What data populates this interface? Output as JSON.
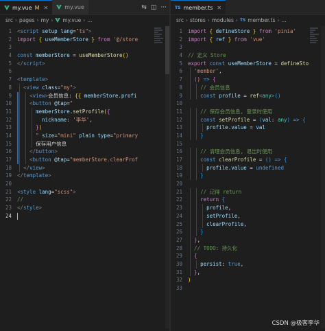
{
  "left": {
    "tabs": [
      {
        "label": "my.vue",
        "modified": "M",
        "active": true
      },
      {
        "label": "my.vue",
        "modified": "",
        "active": false
      }
    ],
    "breadcrumb": [
      "src",
      "pages",
      "my",
      "my.vue",
      "..."
    ],
    "lines": [
      {
        "n": "1",
        "parts": [
          [
            "t-punc",
            "<"
          ],
          [
            "t-tag",
            "script"
          ],
          [
            "t-txt",
            " "
          ],
          [
            "t-attr",
            "setup"
          ],
          [
            "t-txt",
            " "
          ],
          [
            "t-attr",
            "lang"
          ],
          [
            "t-txt",
            "="
          ],
          [
            "t-str",
            "\"ts\""
          ],
          [
            "t-punc",
            ">"
          ]
        ]
      },
      {
        "n": "2",
        "parts": [
          [
            "t-kw",
            "import"
          ],
          [
            "t-txt",
            " "
          ],
          [
            "t-br1",
            "{"
          ],
          [
            "t-txt",
            " "
          ],
          [
            "t-var",
            "useMemberStore"
          ],
          [
            "t-txt",
            " "
          ],
          [
            "t-br1",
            "}"
          ],
          [
            "t-txt",
            " "
          ],
          [
            "t-kw",
            "from"
          ],
          [
            "t-txt",
            " "
          ],
          [
            "t-str",
            "'@/store"
          ]
        ]
      },
      {
        "n": "3",
        "parts": []
      },
      {
        "n": "4",
        "parts": [
          [
            "t-decl",
            "const"
          ],
          [
            "t-txt",
            " "
          ],
          [
            "t-var",
            "memberStore"
          ],
          [
            "t-txt",
            " = "
          ],
          [
            "t-fn",
            "useMemberStore"
          ],
          [
            "t-br1",
            "()"
          ]
        ]
      },
      {
        "n": "5",
        "parts": [
          [
            "t-punc",
            "</"
          ],
          [
            "t-tag",
            "script"
          ],
          [
            "t-punc",
            ">"
          ]
        ]
      },
      {
        "n": "6",
        "parts": []
      },
      {
        "n": "7",
        "parts": [
          [
            "t-punc",
            "<"
          ],
          [
            "t-tag",
            "template"
          ],
          [
            "t-punc",
            ">"
          ]
        ]
      },
      {
        "n": "8",
        "parts": [
          [
            "t-txt",
            "  "
          ],
          [
            "t-punc",
            "<"
          ],
          [
            "t-tag",
            "view"
          ],
          [
            "t-txt",
            " "
          ],
          [
            "t-attr",
            "class"
          ],
          [
            "t-txt",
            "="
          ],
          [
            "t-str",
            "\"my\""
          ],
          [
            "t-punc",
            ">"
          ]
        ]
      },
      {
        "n": "9",
        "parts": [
          [
            "t-txt",
            "    "
          ],
          [
            "t-punc",
            "<"
          ],
          [
            "t-tag",
            "view"
          ],
          [
            "t-punc",
            ">"
          ],
          [
            "t-txt",
            "会员信息: "
          ],
          [
            "t-br1",
            "{{"
          ],
          [
            "t-txt",
            " "
          ],
          [
            "t-var",
            "memberStore"
          ],
          [
            "t-txt",
            "."
          ],
          [
            "t-var",
            "profi"
          ]
        ]
      },
      {
        "n": "10",
        "parts": [
          [
            "t-txt",
            "    "
          ],
          [
            "t-punc",
            "<"
          ],
          [
            "t-tag",
            "button"
          ],
          [
            "t-txt",
            " "
          ],
          [
            "t-attr",
            "@tap"
          ],
          [
            "t-txt",
            "="
          ],
          [
            "t-str",
            "\""
          ]
        ]
      },
      {
        "n": "11",
        "parts": [
          [
            "t-txt",
            "      "
          ],
          [
            "t-var",
            "memberStore"
          ],
          [
            "t-txt",
            "."
          ],
          [
            "t-fn",
            "setProfile"
          ],
          [
            "t-br1",
            "("
          ],
          [
            "t-br2",
            "{"
          ]
        ]
      },
      {
        "n": "12",
        "parts": [
          [
            "t-txt",
            "        "
          ],
          [
            "t-var",
            "nickname"
          ],
          [
            "t-txt",
            ": "
          ],
          [
            "t-str",
            "'李华'"
          ],
          [
            "t-txt",
            ","
          ]
        ]
      },
      {
        "n": "13",
        "parts": [
          [
            "t-txt",
            "      "
          ],
          [
            "t-br2",
            "}"
          ],
          [
            "t-br1",
            ")"
          ]
        ]
      },
      {
        "n": "14",
        "parts": [
          [
            "t-txt",
            "      "
          ],
          [
            "t-str",
            "\""
          ],
          [
            "t-txt",
            " "
          ],
          [
            "t-attr",
            "size"
          ],
          [
            "t-txt",
            "="
          ],
          [
            "t-str",
            "\"mini\""
          ],
          [
            "t-txt",
            " "
          ],
          [
            "t-attr",
            "plain"
          ],
          [
            "t-txt",
            " "
          ],
          [
            "t-attr",
            "type"
          ],
          [
            "t-txt",
            "="
          ],
          [
            "t-str",
            "\"primary"
          ]
        ]
      },
      {
        "n": "15",
        "parts": [
          [
            "t-txt",
            "      保存用户信息"
          ]
        ]
      },
      {
        "n": "16",
        "parts": [
          [
            "t-txt",
            "    "
          ],
          [
            "t-punc",
            "</"
          ],
          [
            "t-tag",
            "button"
          ],
          [
            "t-punc",
            ">"
          ]
        ]
      },
      {
        "n": "17",
        "parts": [
          [
            "t-txt",
            "    "
          ],
          [
            "t-punc",
            "<"
          ],
          [
            "t-tag",
            "button"
          ],
          [
            "t-txt",
            " "
          ],
          [
            "t-attr",
            "@tap"
          ],
          [
            "t-txt",
            "="
          ],
          [
            "t-str",
            "\"memberStore.clearProf"
          ]
        ]
      },
      {
        "n": "18",
        "parts": [
          [
            "t-txt",
            "  "
          ],
          [
            "t-punc",
            "</"
          ],
          [
            "t-tag",
            "view"
          ],
          [
            "t-punc",
            ">"
          ]
        ]
      },
      {
        "n": "19",
        "parts": [
          [
            "t-punc",
            "</"
          ],
          [
            "t-tag",
            "template"
          ],
          [
            "t-punc",
            ">"
          ]
        ]
      },
      {
        "n": "20",
        "parts": []
      },
      {
        "n": "21",
        "parts": [
          [
            "t-punc",
            "<"
          ],
          [
            "t-tag",
            "style"
          ],
          [
            "t-txt",
            " "
          ],
          [
            "t-attr",
            "lang"
          ],
          [
            "t-txt",
            "="
          ],
          [
            "t-str",
            "\"scss\""
          ],
          [
            "t-punc",
            ">"
          ]
        ]
      },
      {
        "n": "22",
        "parts": [
          [
            "t-com",
            "//"
          ]
        ]
      },
      {
        "n": "23",
        "parts": [
          [
            "t-punc",
            "</"
          ],
          [
            "t-tag",
            "style"
          ],
          [
            "t-punc",
            ">"
          ]
        ]
      },
      {
        "n": "24",
        "parts": [],
        "current": true
      }
    ]
  },
  "right": {
    "tabs": [
      {
        "label": "member.ts",
        "modified": "",
        "active": true
      }
    ],
    "breadcrumb": [
      "src",
      "stores",
      "modules",
      "member.ts",
      "..."
    ],
    "lines": [
      {
        "n": "1",
        "parts": [
          [
            "t-kw",
            "import"
          ],
          [
            "t-txt",
            " "
          ],
          [
            "t-br1",
            "{"
          ],
          [
            "t-txt",
            " "
          ],
          [
            "t-var",
            "defineStore"
          ],
          [
            "t-txt",
            " "
          ],
          [
            "t-br1",
            "}"
          ],
          [
            "t-txt",
            " "
          ],
          [
            "t-kw",
            "from"
          ],
          [
            "t-txt",
            " "
          ],
          [
            "t-str",
            "'pinia'"
          ]
        ]
      },
      {
        "n": "2",
        "parts": [
          [
            "t-kw",
            "import"
          ],
          [
            "t-txt",
            " "
          ],
          [
            "t-br1",
            "{"
          ],
          [
            "t-txt",
            " "
          ],
          [
            "t-var",
            "ref"
          ],
          [
            "t-txt",
            " "
          ],
          [
            "t-br1",
            "}"
          ],
          [
            "t-txt",
            " "
          ],
          [
            "t-kw",
            "from"
          ],
          [
            "t-txt",
            " "
          ],
          [
            "t-str",
            "'vue'"
          ]
        ]
      },
      {
        "n": "3",
        "parts": []
      },
      {
        "n": "4",
        "parts": [
          [
            "t-com",
            "// 定义 Store"
          ]
        ]
      },
      {
        "n": "5",
        "parts": [
          [
            "t-kw",
            "export"
          ],
          [
            "t-txt",
            " "
          ],
          [
            "t-decl",
            "const"
          ],
          [
            "t-txt",
            " "
          ],
          [
            "t-var",
            "useMemberStore"
          ],
          [
            "t-txt",
            " = "
          ],
          [
            "t-fn",
            "defineSto"
          ]
        ]
      },
      {
        "n": "6",
        "parts": [
          [
            "t-txt",
            "  "
          ],
          [
            "t-str",
            "'member'"
          ],
          [
            "t-txt",
            ","
          ]
        ]
      },
      {
        "n": "7",
        "parts": [
          [
            "t-txt",
            "  "
          ],
          [
            "t-br2",
            "()"
          ],
          [
            "t-txt",
            " "
          ],
          [
            "t-decl",
            "=>"
          ],
          [
            "t-txt",
            " "
          ],
          [
            "t-br2",
            "{"
          ]
        ]
      },
      {
        "n": "8",
        "parts": [
          [
            "t-txt",
            "    "
          ],
          [
            "t-com",
            "// 会员信息"
          ]
        ]
      },
      {
        "n": "9",
        "parts": [
          [
            "t-txt",
            "    "
          ],
          [
            "t-decl",
            "const"
          ],
          [
            "t-txt",
            " "
          ],
          [
            "t-var",
            "profile"
          ],
          [
            "t-txt",
            " = "
          ],
          [
            "t-fn",
            "ref"
          ],
          [
            "t-punc",
            "<"
          ],
          [
            "t-cls",
            "any"
          ],
          [
            "t-punc",
            ">"
          ],
          [
            "t-br3",
            "()"
          ]
        ]
      },
      {
        "n": "10",
        "parts": []
      },
      {
        "n": "11",
        "parts": [
          [
            "t-txt",
            "    "
          ],
          [
            "t-com",
            "// 保存会员信息, 登录时使用"
          ]
        ]
      },
      {
        "n": "12",
        "parts": [
          [
            "t-txt",
            "    "
          ],
          [
            "t-decl",
            "const"
          ],
          [
            "t-txt",
            " "
          ],
          [
            "t-fn",
            "setProfile"
          ],
          [
            "t-txt",
            " = "
          ],
          [
            "t-br3",
            "("
          ],
          [
            "t-var",
            "val"
          ],
          [
            "t-txt",
            ": "
          ],
          [
            "t-cls",
            "any"
          ],
          [
            "t-br3",
            ")"
          ],
          [
            "t-txt",
            " "
          ],
          [
            "t-decl",
            "=>"
          ],
          [
            "t-txt",
            " "
          ],
          [
            "t-br3",
            "{"
          ]
        ]
      },
      {
        "n": "13",
        "parts": [
          [
            "t-txt",
            "      "
          ],
          [
            "t-var",
            "profile"
          ],
          [
            "t-txt",
            "."
          ],
          [
            "t-var",
            "value"
          ],
          [
            "t-txt",
            " = "
          ],
          [
            "t-var",
            "val"
          ]
        ]
      },
      {
        "n": "14",
        "parts": [
          [
            "t-txt",
            "    "
          ],
          [
            "t-br3",
            "}"
          ]
        ]
      },
      {
        "n": "15",
        "parts": []
      },
      {
        "n": "16",
        "parts": [
          [
            "t-txt",
            "    "
          ],
          [
            "t-com",
            "// 清理会员信息, 退出时使用"
          ]
        ]
      },
      {
        "n": "17",
        "parts": [
          [
            "t-txt",
            "    "
          ],
          [
            "t-decl",
            "const"
          ],
          [
            "t-txt",
            " "
          ],
          [
            "t-fn",
            "clearProfile"
          ],
          [
            "t-txt",
            " = "
          ],
          [
            "t-br3",
            "()"
          ],
          [
            "t-txt",
            " "
          ],
          [
            "t-decl",
            "=>"
          ],
          [
            "t-txt",
            " "
          ],
          [
            "t-br3",
            "{"
          ]
        ]
      },
      {
        "n": "18",
        "parts": [
          [
            "t-txt",
            "      "
          ],
          [
            "t-var",
            "profile"
          ],
          [
            "t-txt",
            "."
          ],
          [
            "t-var",
            "value"
          ],
          [
            "t-txt",
            " = "
          ],
          [
            "t-decl",
            "undefined"
          ]
        ]
      },
      {
        "n": "19",
        "parts": [
          [
            "t-txt",
            "    "
          ],
          [
            "t-br3",
            "}"
          ]
        ]
      },
      {
        "n": "20",
        "parts": []
      },
      {
        "n": "21",
        "parts": [
          [
            "t-txt",
            "    "
          ],
          [
            "t-com",
            "// 记得 return"
          ]
        ]
      },
      {
        "n": "22",
        "parts": [
          [
            "t-txt",
            "    "
          ],
          [
            "t-kw",
            "return"
          ],
          [
            "t-txt",
            " "
          ],
          [
            "t-br3",
            "{"
          ]
        ]
      },
      {
        "n": "23",
        "parts": [
          [
            "t-txt",
            "      "
          ],
          [
            "t-var",
            "profile"
          ],
          [
            "t-txt",
            ","
          ]
        ]
      },
      {
        "n": "24",
        "parts": [
          [
            "t-txt",
            "      "
          ],
          [
            "t-var",
            "setProfile"
          ],
          [
            "t-txt",
            ","
          ]
        ]
      },
      {
        "n": "25",
        "parts": [
          [
            "t-txt",
            "      "
          ],
          [
            "t-var",
            "clearProfile"
          ],
          [
            "t-txt",
            ","
          ]
        ]
      },
      {
        "n": "26",
        "parts": [
          [
            "t-txt",
            "    "
          ],
          [
            "t-br3",
            "}"
          ]
        ]
      },
      {
        "n": "27",
        "parts": [
          [
            "t-txt",
            "  "
          ],
          [
            "t-br2",
            "}"
          ],
          [
            "t-txt",
            ","
          ]
        ]
      },
      {
        "n": "28",
        "parts": [
          [
            "t-txt",
            "  "
          ],
          [
            "t-com",
            "// TODO: 持久化"
          ]
        ]
      },
      {
        "n": "29",
        "parts": [
          [
            "t-txt",
            "  "
          ],
          [
            "t-br2",
            "{"
          ]
        ]
      },
      {
        "n": "30",
        "parts": [
          [
            "t-txt",
            "    "
          ],
          [
            "t-var",
            "persist"
          ],
          [
            "t-txt",
            ": "
          ],
          [
            "t-decl",
            "true"
          ],
          [
            "t-txt",
            ","
          ]
        ]
      },
      {
        "n": "31",
        "parts": [
          [
            "t-txt",
            "  "
          ],
          [
            "t-br2",
            "}"
          ],
          [
            "t-txt",
            ","
          ]
        ]
      },
      {
        "n": "32",
        "parts": [
          [
            "t-br1",
            ")"
          ]
        ]
      },
      {
        "n": "33",
        "parts": []
      }
    ]
  },
  "watermark": "CSDN @极客李华",
  "colors": {
    "accent": "#0078d4",
    "modified": "#e2c08d",
    "vue_green": "#41b883",
    "ts_blue": "#4f9ff3"
  }
}
